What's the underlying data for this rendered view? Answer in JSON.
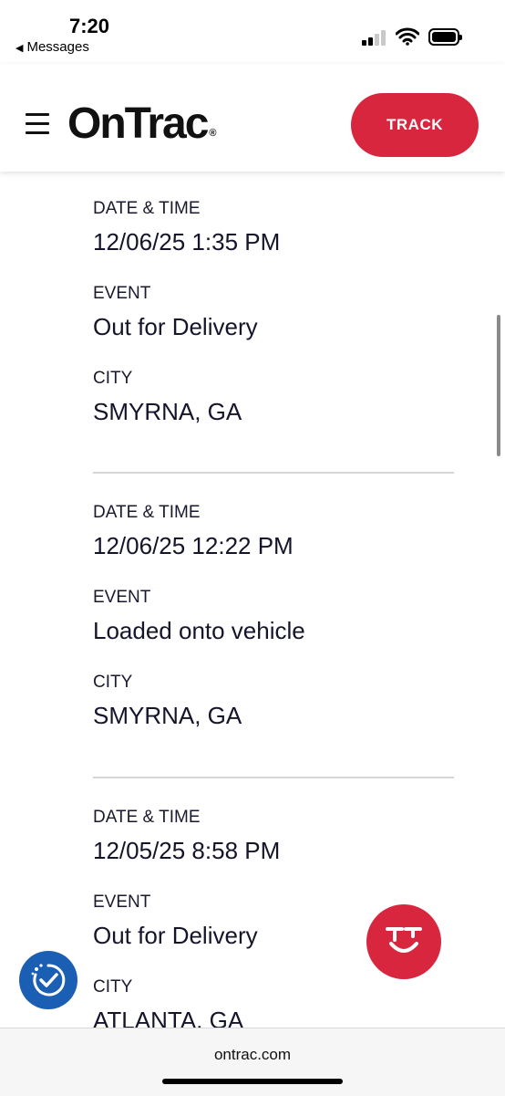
{
  "status_bar": {
    "time": "7:20",
    "back_app": "Messages"
  },
  "header": {
    "logo_text": "OnTrac",
    "logo_reg": "®",
    "track_label": "TRACK"
  },
  "events": [
    {
      "datetime_label": "DATE & TIME",
      "datetime": "12/06/25 1:35 PM",
      "event_label": "EVENT",
      "event": "Out for Delivery",
      "city_label": "CITY",
      "city": "SMYRNA, GA"
    },
    {
      "datetime_label": "DATE & TIME",
      "datetime": "12/06/25 12:22 PM",
      "event_label": "EVENT",
      "event": "Loaded onto vehicle",
      "city_label": "CITY",
      "city": "SMYRNA, GA"
    },
    {
      "datetime_label": "DATE & TIME",
      "datetime": "12/05/25 8:58 PM",
      "event_label": "EVENT",
      "event": "Out for Delivery",
      "city_label": "CITY",
      "city": "ATLANTA, GA"
    }
  ],
  "colors": {
    "brand_red": "#d7263d",
    "accessibility_blue": "#1a5fb4"
  },
  "icons": {
    "menu": "hamburger-icon",
    "chat": "ontrac-chat-icon",
    "accessibility": "accessibility-check-icon"
  },
  "browser": {
    "url": "ontrac.com"
  }
}
